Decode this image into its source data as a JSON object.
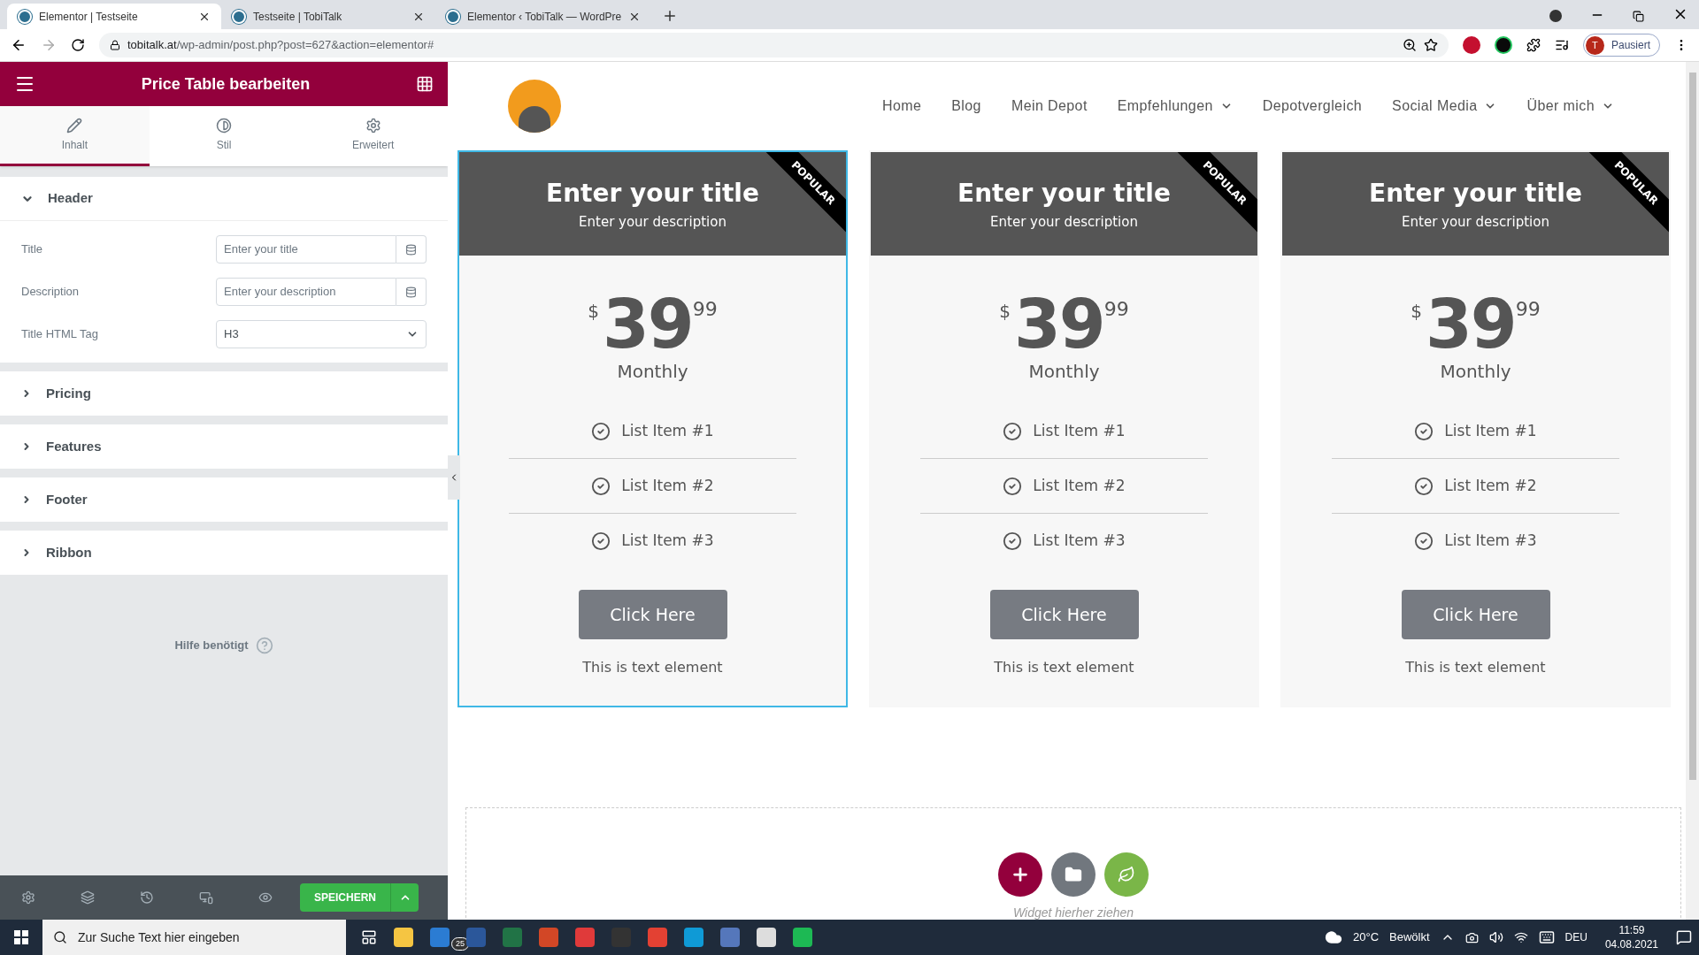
{
  "browser": {
    "tabs": [
      {
        "title": "Elementor | Testseite",
        "selected": true
      },
      {
        "title": "Testseite | TobiTalk",
        "selected": false
      },
      {
        "title": "Elementor ‹ TobiTalk — WordPre",
        "selected": false
      }
    ],
    "url_host": "tobitalk.at",
    "url_path": "/wp-admin/post.php?post=627&action=elementor#",
    "profile_initial": "T",
    "profile_label": "Pausiert"
  },
  "panel": {
    "title": "Price Table bearbeiten",
    "tabs": [
      {
        "label": "Inhalt",
        "kind": "pencil",
        "selected": true
      },
      {
        "label": "Stil",
        "kind": "contrast",
        "selected": false
      },
      {
        "label": "Erweitert",
        "kind": "gear",
        "selected": false
      }
    ],
    "sections": [
      {
        "title": "Header",
        "expanded": true,
        "controls": [
          {
            "label": "Title",
            "kind": "text",
            "placeholder": "Enter your title"
          },
          {
            "label": "Description",
            "kind": "text",
            "placeholder": "Enter your description"
          },
          {
            "label": "Title HTML Tag",
            "kind": "select",
            "value": "H3"
          }
        ]
      },
      {
        "title": "Pricing",
        "expanded": false
      },
      {
        "title": "Features",
        "expanded": false
      },
      {
        "title": "Footer",
        "expanded": false
      },
      {
        "title": "Ribbon",
        "expanded": false
      }
    ],
    "help": "Hilfe benötigt",
    "save": "SPEICHERN"
  },
  "site": {
    "nav": [
      {
        "label": "Home",
        "dropdown": false
      },
      {
        "label": "Blog",
        "dropdown": false
      },
      {
        "label": "Mein Depot",
        "dropdown": false
      },
      {
        "label": "Empfehlungen",
        "dropdown": true
      },
      {
        "label": "Depotvergleich",
        "dropdown": false
      },
      {
        "label": "Social Media",
        "dropdown": true
      },
      {
        "label": "Über mich",
        "dropdown": true
      }
    ],
    "cards": [
      {
        "selected": true,
        "title": "Enter your title",
        "description": "Enter your description",
        "ribbon": "POPULAR",
        "currency": "$",
        "price": "39",
        "fraction": "99",
        "period": "Monthly",
        "features": [
          "List Item #1",
          "List Item #2",
          "List Item #3"
        ],
        "button": "Click Here",
        "footer": "This is text element"
      },
      {
        "selected": false,
        "title": "Enter your title",
        "description": "Enter your description",
        "ribbon": "POPULAR",
        "currency": "$",
        "price": "39",
        "fraction": "99",
        "period": "Monthly",
        "features": [
          "List Item #1",
          "List Item #2",
          "List Item #3"
        ],
        "button": "Click Here",
        "footer": "This is text element"
      },
      {
        "selected": false,
        "title": "Enter your title",
        "description": "Enter your description",
        "ribbon": "POPULAR",
        "currency": "$",
        "price": "39",
        "fraction": "99",
        "period": "Monthly",
        "features": [
          "List Item #1",
          "List Item #2",
          "List Item #3"
        ],
        "button": "Click Here",
        "footer": "This is text element"
      }
    ],
    "drop_hint": "Widget hierher ziehen"
  },
  "taskbar": {
    "search_placeholder": "Zur Suche Text hier eingeben",
    "mail_badge": "25",
    "temperature": "20°C",
    "weather": "Bewölkt",
    "language": "DEU",
    "time": "11:59",
    "date": "04.08.2021"
  }
}
